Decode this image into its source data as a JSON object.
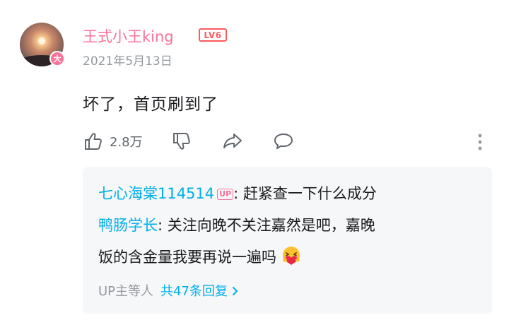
{
  "comment": {
    "username": "王式小王king",
    "level": "LV6",
    "vip_badge": "大",
    "date": "2021年5月13日",
    "text": "坏了，首页刷到了",
    "like_count": "2.8万"
  },
  "icons": [
    "thumbs-up-icon",
    "thumbs-down-icon",
    "share-icon",
    "comment-icon",
    "more-vertical-icon",
    "chevron-right-icon"
  ],
  "replies": [
    {
      "name": "七心海棠114514",
      "tag": "UP",
      "sep": ": ",
      "text": "赶紧查一下什么成分"
    },
    {
      "name": "鸭肠学长",
      "sep": ": ",
      "text_line1": "关注向晚不关注嘉然是吧，嘉晚",
      "text_line2": "饭的含金量我要再说一遍吗"
    }
  ],
  "reply_footer": {
    "people": "UP主等人",
    "count": "共47条回复"
  },
  "colors": {
    "accent_pink": "#fb7299",
    "link_blue": "#00aeec",
    "level_red": "#ff5a5f",
    "muted_gray": "#9499a0"
  }
}
